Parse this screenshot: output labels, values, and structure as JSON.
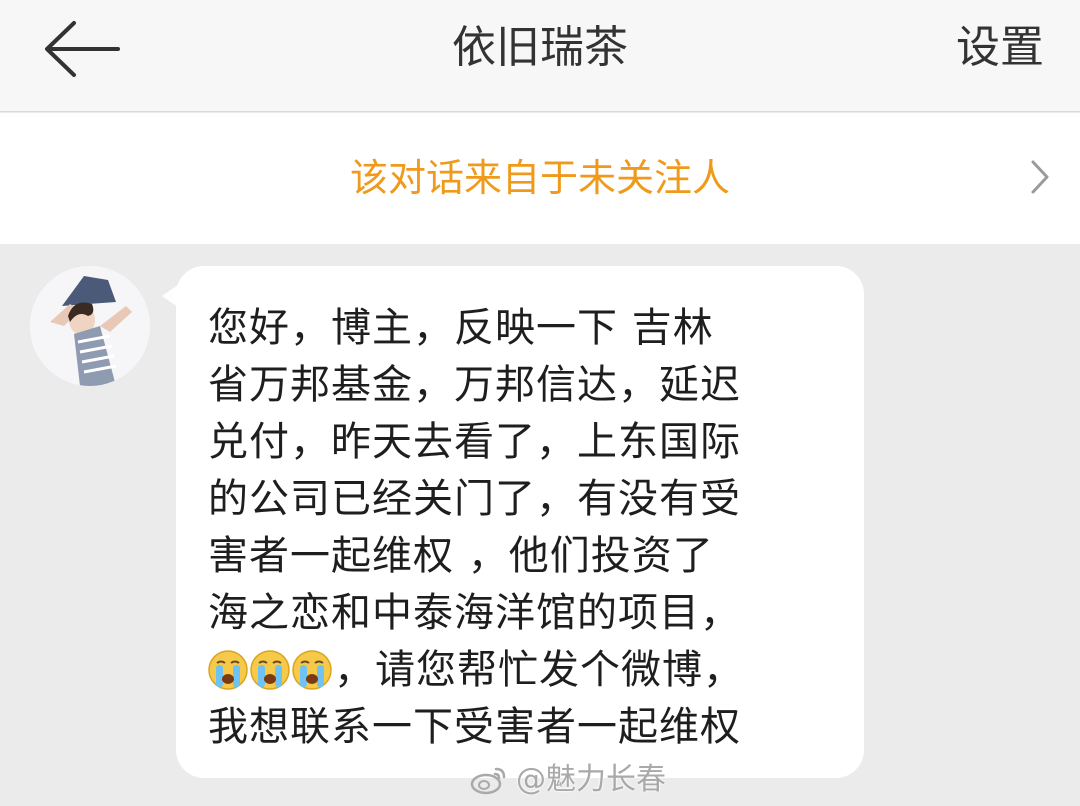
{
  "header": {
    "title": "依旧瑞茶",
    "settings_label": "设置",
    "back_icon": "arrow-left-icon"
  },
  "notice": {
    "text": "该对话来自于未关注人",
    "chevron_icon": "chevron-right-icon",
    "text_color": "#f09a1b"
  },
  "conversation": {
    "messages": [
      {
        "sender": "依旧瑞茶",
        "lines": [
          "您好，博主，反映一下 吉林",
          "省万邦基金，万邦信达，延迟",
          "兑付，昨天去看了，上东国际",
          "的公司已经关门了，有没有受",
          "害者一起维权 ，他们投资了",
          "海之恋和中泰海洋馆的项目，",
          "，请您帮忙发个微博，",
          "我想联系一下受害者一起维权"
        ],
        "emoji_icon": "crying-face-icon",
        "emoji_count": 3
      }
    ]
  },
  "watermark": {
    "text": "@魅力长春",
    "icon": "weibo-logo-icon"
  },
  "colors": {
    "chat_background": "#ebebeb",
    "header_background": "#f7f7f7",
    "bubble_background": "#ffffff",
    "text": "#1e1e1e"
  }
}
